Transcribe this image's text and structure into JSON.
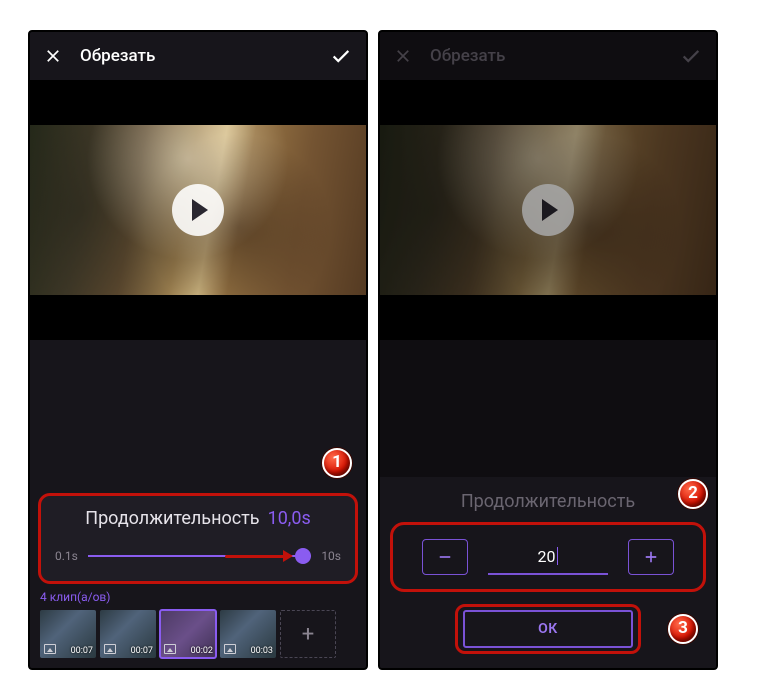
{
  "header": {
    "title": "Обрезать"
  },
  "duration": {
    "label": "Продолжительность",
    "value": "10,0s",
    "min": "0.1s",
    "max": "10s"
  },
  "clips": {
    "count_label": "4 клип(а/ов)",
    "items": [
      {
        "time": "00:07"
      },
      {
        "time": "00:07"
      },
      {
        "time": "00:02"
      },
      {
        "time": "00:03"
      }
    ]
  },
  "stepper": {
    "duration_label": "Продолжительность",
    "value": "20",
    "ok": "ОК"
  },
  "badges": {
    "b1": "1",
    "b2": "2",
    "b3": "3"
  }
}
